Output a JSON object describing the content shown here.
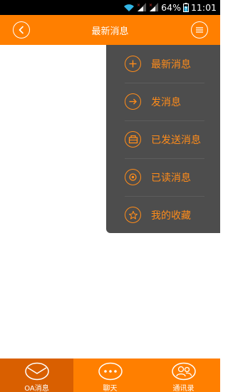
{
  "status_bar": {
    "battery": "64%",
    "time": "11:01",
    "icons": [
      "wifi-icon",
      "signal-icon",
      "signal-icon",
      "battery-icon"
    ]
  },
  "top_bar": {
    "title": "最新消息",
    "back_icon": "chevron-left-icon",
    "menu_icon": "menu-lines-icon"
  },
  "dropdown": {
    "items": [
      {
        "label": "最新消息",
        "icon": "plus-icon"
      },
      {
        "label": "发消息",
        "icon": "arrow-right-icon"
      },
      {
        "label": "已发送消息",
        "icon": "outbox-icon"
      },
      {
        "label": "已读消息",
        "icon": "eye-icon"
      },
      {
        "label": "我的收藏",
        "icon": "star-icon"
      }
    ]
  },
  "tab_bar": {
    "tabs": [
      {
        "label": "OA消息",
        "icon": "envelope-icon",
        "active": true
      },
      {
        "label": "聊天",
        "icon": "chat-bubble-icon",
        "active": false
      },
      {
        "label": "通讯录",
        "icon": "contacts-icon",
        "active": false
      }
    ]
  },
  "colors": {
    "accent": "#ff7f00",
    "accent_dark": "#d95f00",
    "menu_bg": "#4d4d4d",
    "menu_text": "#ff8c1a"
  }
}
